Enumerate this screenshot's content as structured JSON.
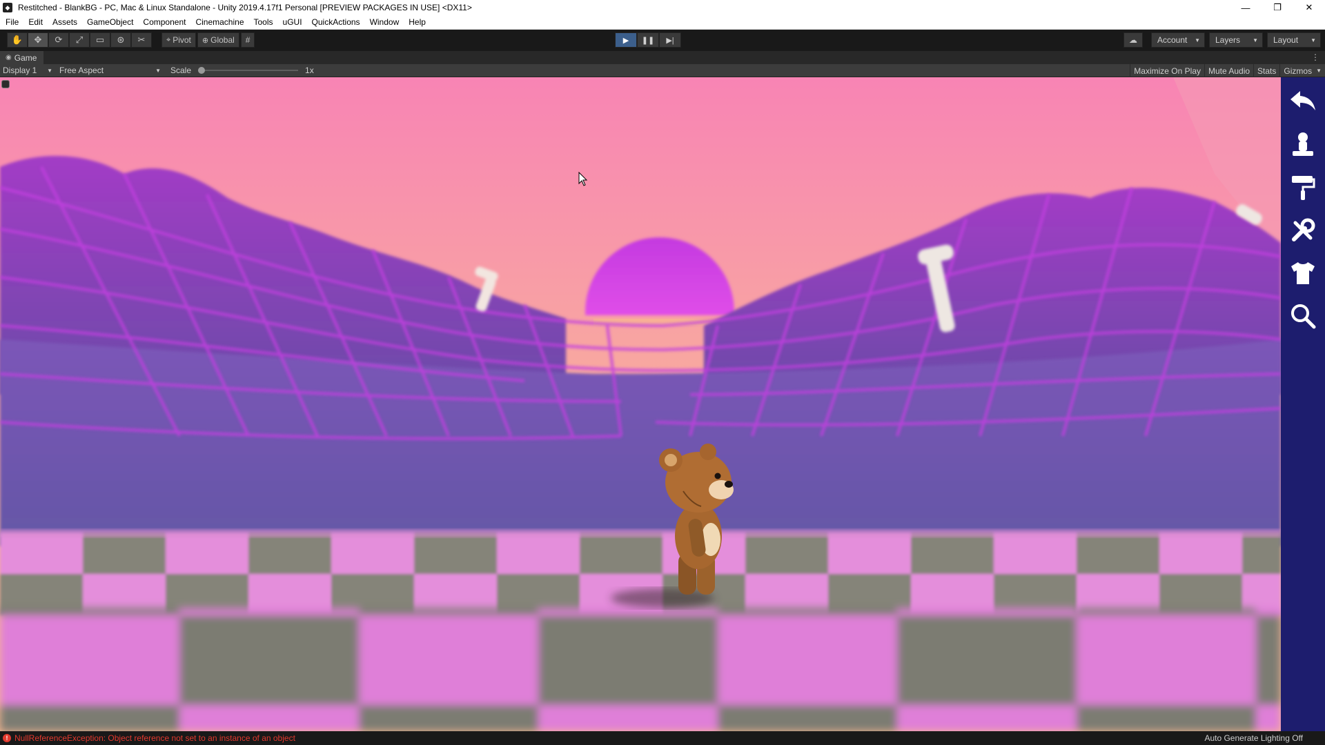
{
  "window": {
    "title": "Restitched - BlankBG - PC, Mac & Linux Standalone - Unity 2019.4.17f1 Personal [PREVIEW PACKAGES IN USE] <DX11>",
    "minimize": "—",
    "maximize": "❐",
    "close": "✕"
  },
  "menu": {
    "items": [
      "File",
      "Edit",
      "Assets",
      "GameObject",
      "Component",
      "Cinemachine",
      "Tools",
      "uGUI",
      "QuickActions",
      "Window",
      "Help"
    ]
  },
  "toolbar": {
    "tools": [
      {
        "icon": "hand-icon",
        "glyph": "✋"
      },
      {
        "icon": "move-icon",
        "glyph": "✥"
      },
      {
        "icon": "rotate-icon",
        "glyph": "⟳"
      },
      {
        "icon": "scale-icon",
        "glyph": "⤢"
      },
      {
        "icon": "rect-icon",
        "glyph": "▭"
      },
      {
        "icon": "transform-icon",
        "glyph": "⊛"
      },
      {
        "icon": "custom-tool-icon",
        "glyph": "✂"
      }
    ],
    "pivot_label": "Pivot",
    "global_label": "Global",
    "grid_glyph": "#",
    "play_glyph": "▶",
    "pause_glyph": "❚❚",
    "step_glyph": "▶|",
    "cloud_glyph": "☁",
    "account_label": "Account",
    "layers_label": "Layers",
    "layout_label": "Layout",
    "caret": "▼"
  },
  "tab": {
    "label": "Game",
    "kebab": "⋮"
  },
  "game_toolbar": {
    "display": "Display 1",
    "aspect": "Free Aspect",
    "scale_label": "Scale",
    "scale_value": "1x",
    "maximize_on_play": "Maximize On Play",
    "mute_audio": "Mute Audio",
    "stats": "Stats",
    "gizmos": "Gizmos"
  },
  "side_panel": {
    "buttons": [
      "back-arrow-icon",
      "character-icon",
      "paint-roller-icon",
      "tools-icon",
      "shirt-icon",
      "search-icon"
    ],
    "color": "#1d1d6e"
  },
  "status": {
    "error_glyph": "!",
    "error_message": "NullReferenceException: Object reference not set to an instance of an object",
    "right_text": "Auto Generate Lighting Off",
    "error_color": "#e3392e"
  },
  "colors": {
    "editor_bg": "#191919",
    "play_active": "#3c5f8c",
    "sky_top": "#f884b4",
    "sky_bottom": "#f8b08f",
    "sun": "#c83de0",
    "grid": "#b53bd7",
    "carpet_pink": "#e78fe0",
    "carpet_gray": "#7c7c72"
  }
}
